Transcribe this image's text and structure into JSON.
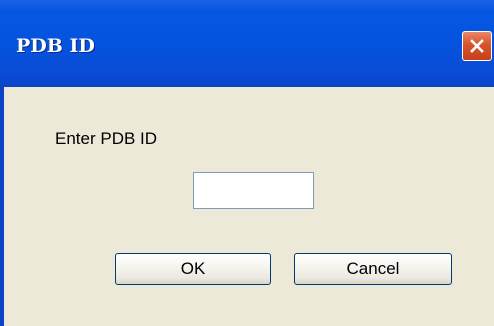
{
  "window": {
    "title": "PDB ID",
    "close_icon": "close-icon"
  },
  "dialog": {
    "prompt_label": "Enter PDB ID",
    "input_value": "",
    "ok_label": "OK",
    "cancel_label": "Cancel"
  },
  "colors": {
    "titlebar": "#0552de",
    "close_button": "#d9532a",
    "client_background": "#ece9d8",
    "button_border": "#003c74",
    "input_border": "#7f9db9"
  }
}
